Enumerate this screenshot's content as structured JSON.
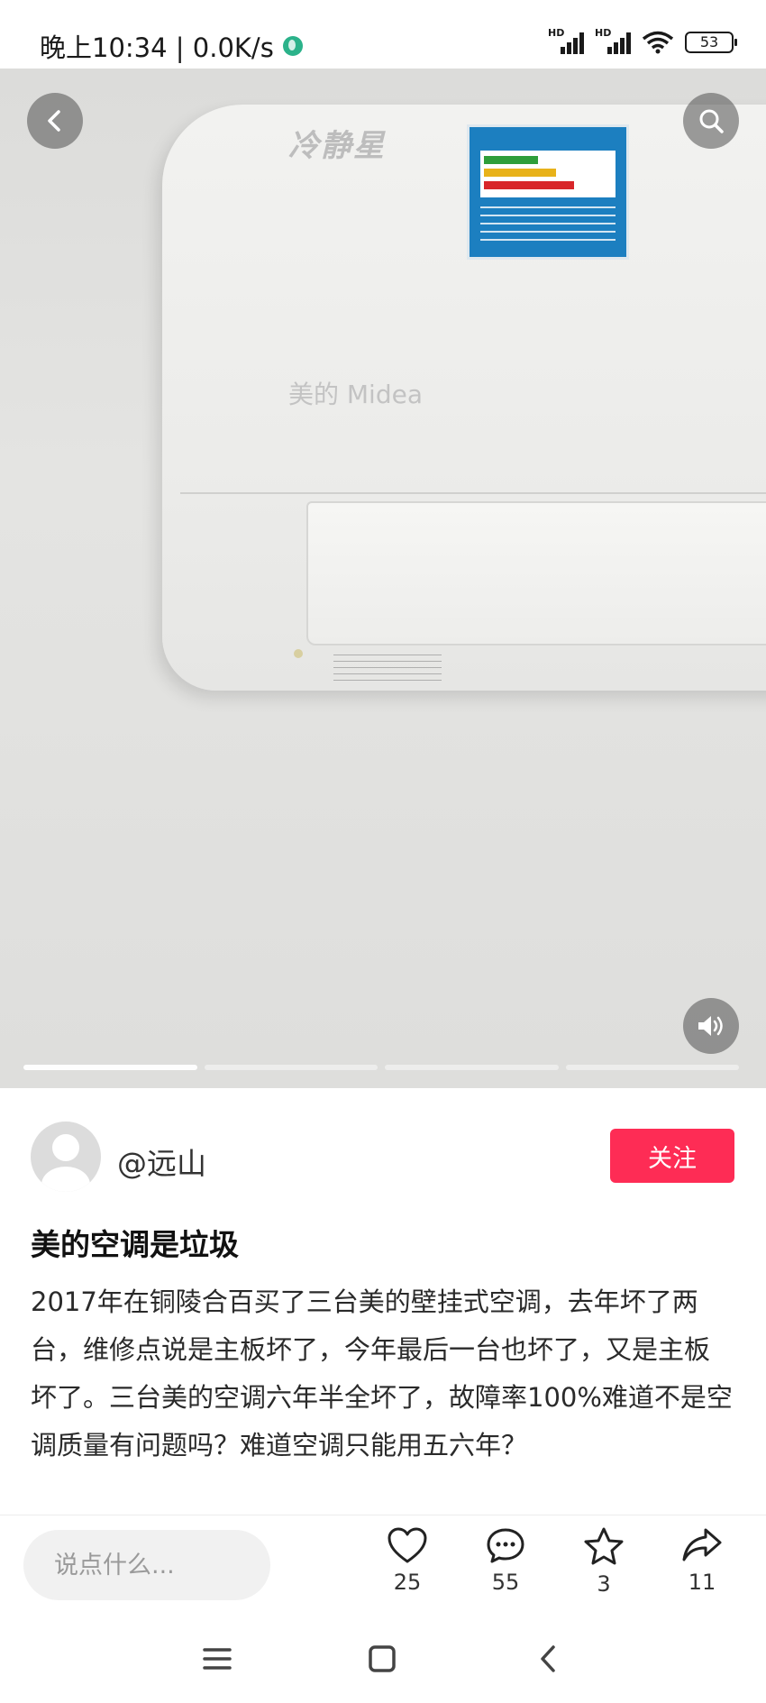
{
  "status_bar": {
    "time_speed": "晚上10:34 | 0.0K/s",
    "signal1_label": "HD",
    "signal2_label": "HD",
    "battery": "53"
  },
  "media": {
    "ac_brand_top": "冷静星",
    "ac_logo": "美的 Midea",
    "carousel_total": 4,
    "carousel_active_index": 0
  },
  "post": {
    "author": "@远山",
    "follow_label": "关注",
    "title": "美的空调是垃圾",
    "body": "2017年在铜陵合百买了三台美的壁挂式空调，去年坏了两台，维修点说是主板坏了，今年最后一台也坏了，又是主板坏了。三台美的空调六年半全坏了，故障率100%难道不是空调质量有问题吗？难道空调只能用五六年？"
  },
  "actions": {
    "comment_placeholder": "说点什么...",
    "like_count": "25",
    "comment_count": "55",
    "favorite_count": "3",
    "share_count": "11"
  },
  "icons": {
    "back": "chevron-left-icon",
    "search": "search-icon",
    "volume": "volume-icon",
    "like": "heart-icon",
    "comment": "comment-icon",
    "favorite": "star-icon",
    "share": "share-icon",
    "nav_menu": "menu-icon",
    "nav_home": "home-square-icon",
    "nav_back": "back-arrow-icon"
  },
  "colors": {
    "follow_button": "#fe2c55",
    "input_bg": "#f1f1f1"
  }
}
